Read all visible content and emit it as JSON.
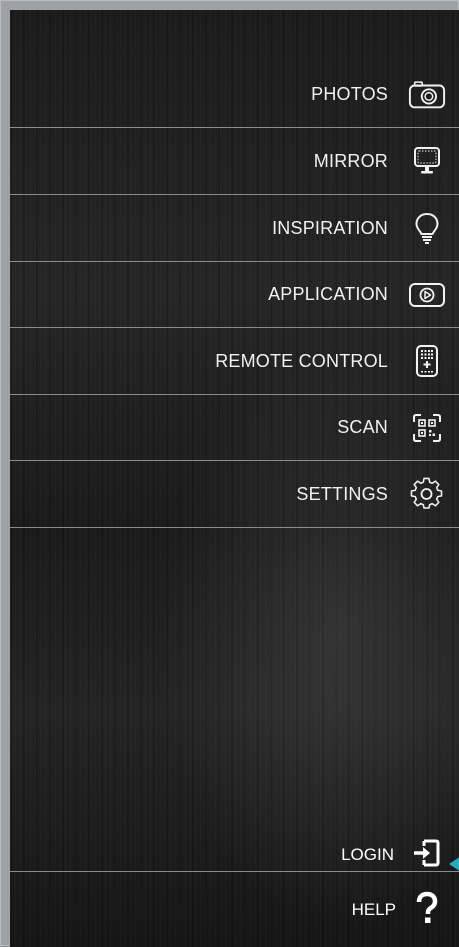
{
  "menu": {
    "items": [
      {
        "label": "PHOTOS",
        "icon": "camera-icon"
      },
      {
        "label": "MIRROR",
        "icon": "monitor-icon"
      },
      {
        "label": "INSPIRATION",
        "icon": "lightbulb-icon"
      },
      {
        "label": "APPLICATION",
        "icon": "play-icon"
      },
      {
        "label": "REMOTE CONTROL",
        "icon": "remote-icon"
      },
      {
        "label": "SCAN",
        "icon": "qr-scan-icon"
      },
      {
        "label": "SETTINGS",
        "icon": "gear-icon"
      }
    ]
  },
  "footer": {
    "login_label": "LOGIN",
    "help_label": "HELP"
  },
  "colors": {
    "accent": "#2aa9b8",
    "text": "#f2f2f2",
    "divider": "#8c8c8c"
  }
}
